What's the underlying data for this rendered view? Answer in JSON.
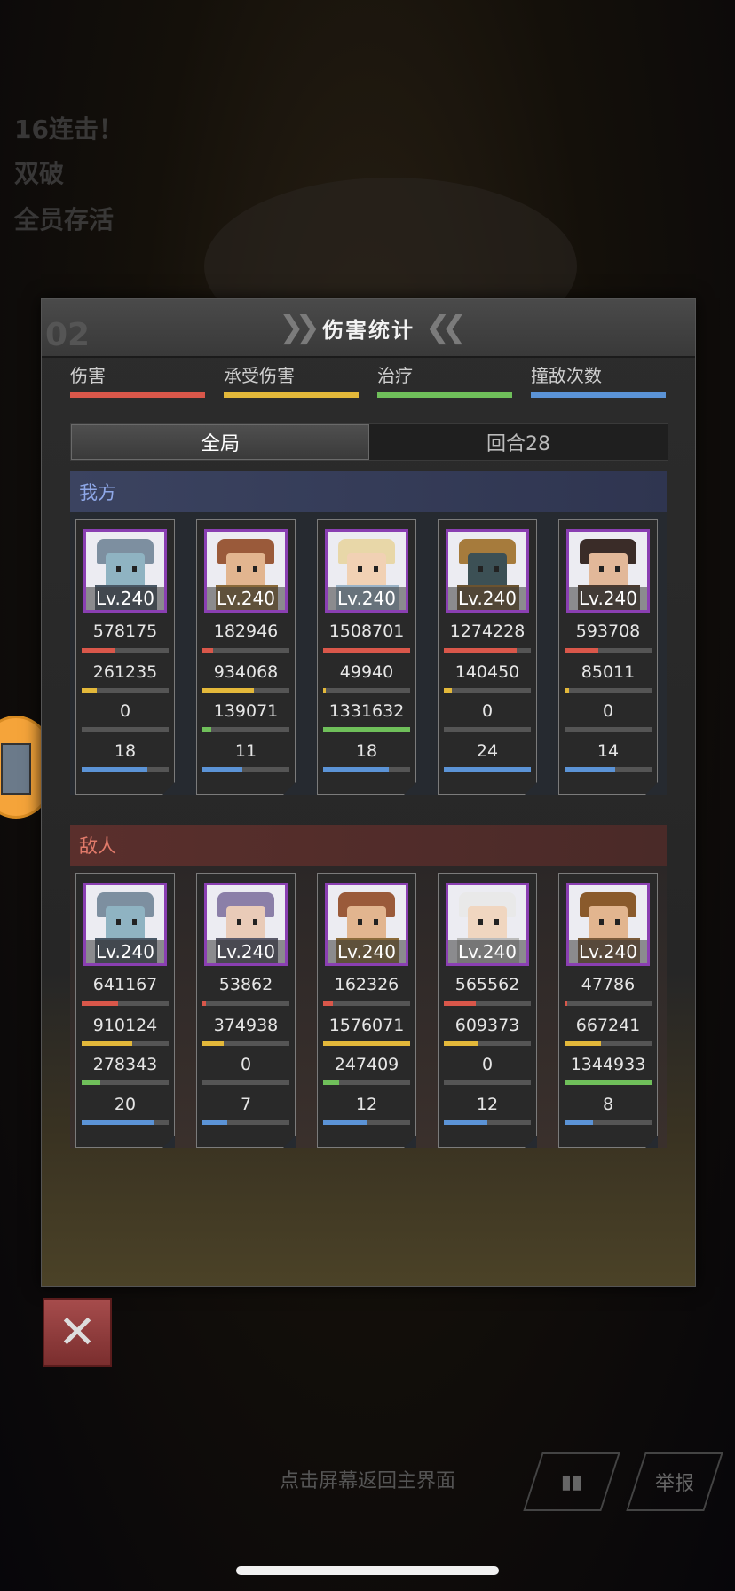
{
  "background": {
    "banners": [
      "16连击！",
      "双破",
      "全员存活"
    ]
  },
  "panel": {
    "title": "伤害统计",
    "deco_number": "02",
    "legend": [
      {
        "label": "伤害",
        "color": "#d9574a"
      },
      {
        "label": "承受伤害",
        "color": "#e3b83a"
      },
      {
        "label": "治疗",
        "color": "#6fbf5a"
      },
      {
        "label": "撞敌次数",
        "color": "#5b93d6"
      }
    ],
    "tabs": [
      {
        "label": "全局",
        "active": true
      },
      {
        "label": "回合28",
        "active": false
      }
    ]
  },
  "ally": {
    "title": "我方",
    "units": [
      {
        "level": "Lv.240",
        "damage": "578175",
        "taken": "261235",
        "heal": "0",
        "hits": "18",
        "bars": [
          0.38,
          0.17,
          0.0,
          0.75
        ],
        "palette": {
          "hair": "#7d8fa0",
          "face": "#8fb3c2",
          "body": "#4a5866"
        }
      },
      {
        "level": "Lv.240",
        "damage": "182946",
        "taken": "934068",
        "heal": "139071",
        "hits": "11",
        "bars": [
          0.12,
          0.59,
          0.1,
          0.46
        ],
        "palette": {
          "hair": "#9a5a3a",
          "face": "#e2b58f",
          "body": "#8a6a3a"
        }
      },
      {
        "level": "Lv.240",
        "damage": "1508701",
        "taken": "49940",
        "heal": "1331632",
        "hits": "18",
        "bars": [
          1.0,
          0.03,
          1.0,
          0.75
        ],
        "palette": {
          "hair": "#e8d7a8",
          "face": "#f1d1b4",
          "body": "#9bb3c7"
        }
      },
      {
        "level": "Lv.240",
        "damage": "1274228",
        "taken": "140450",
        "heal": "0",
        "hits": "24",
        "bars": [
          0.84,
          0.09,
          0.0,
          1.0
        ],
        "palette": {
          "hair": "#a67b3c",
          "face": "#3c5055",
          "body": "#6b5330"
        }
      },
      {
        "level": "Lv.240",
        "damage": "593708",
        "taken": "85011",
        "heal": "0",
        "hits": "14",
        "bars": [
          0.39,
          0.05,
          0.0,
          0.58
        ],
        "palette": {
          "hair": "#3a2c28",
          "face": "#e2b899",
          "body": "#4a3a30"
        }
      }
    ]
  },
  "enemy": {
    "title": "敌人",
    "units": [
      {
        "level": "Lv.240",
        "damage": "641167",
        "taken": "910124",
        "heal": "278343",
        "hits": "20",
        "bars": [
          0.42,
          0.58,
          0.21,
          0.83
        ],
        "palette": {
          "hair": "#7d8fa0",
          "face": "#8fb3c2",
          "body": "#4a5866"
        }
      },
      {
        "level": "Lv.240",
        "damage": "53862",
        "taken": "374938",
        "heal": "0",
        "hits": "7",
        "bars": [
          0.04,
          0.24,
          0.0,
          0.29
        ],
        "palette": {
          "hair": "#8b7fa8",
          "face": "#e9cbb8",
          "body": "#5a5a6a"
        }
      },
      {
        "level": "Lv.240",
        "damage": "162326",
        "taken": "1576071",
        "heal": "247409",
        "hits": "12",
        "bars": [
          0.11,
          1.0,
          0.18,
          0.5
        ],
        "palette": {
          "hair": "#9a5a3a",
          "face": "#e2b58f",
          "body": "#8a6a3a"
        }
      },
      {
        "level": "Lv.240",
        "damage": "565562",
        "taken": "609373",
        "heal": "0",
        "hits": "12",
        "bars": [
          0.37,
          0.39,
          0.0,
          0.5
        ],
        "palette": {
          "hair": "#e9e9e9",
          "face": "#f0d6c0",
          "body": "#bcbcbc"
        }
      },
      {
        "level": "Lv.240",
        "damage": "47786",
        "taken": "667241",
        "heal": "1344933",
        "hits": "8",
        "bars": [
          0.03,
          0.42,
          1.0,
          0.33
        ],
        "palette": {
          "hair": "#8a5a2c",
          "face": "#e2b58f",
          "body": "#7a5a3a"
        }
      }
    ]
  },
  "footer": {
    "hint": "点击屏幕返回主界面",
    "close_icon": "close-icon",
    "stats_icon": "bar-chart-icon",
    "report_label": "举报"
  }
}
